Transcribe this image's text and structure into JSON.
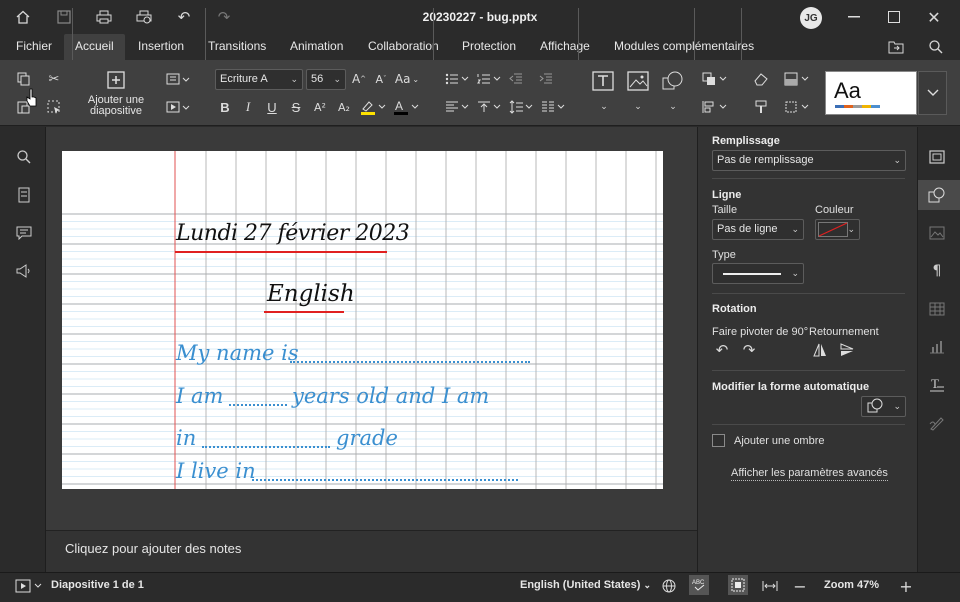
{
  "window": {
    "title": "20230227 - bug.pptx",
    "user_initials": "JG"
  },
  "menu": {
    "tabs": [
      "Fichier",
      "Accueil",
      "Insertion",
      "Transitions",
      "Animation",
      "Collaboration",
      "Protection",
      "Affichage",
      "Modules complémentaires"
    ],
    "active": "Accueil"
  },
  "ribbon": {
    "add_slide_line1": "Ajouter une",
    "add_slide_line2": "diapositive",
    "font_name": "Ecriture A",
    "font_size": "56",
    "font_grow": "A",
    "font_shrink": "A",
    "change_case": "Aa",
    "bold": "B",
    "italic": "I",
    "underline": "U",
    "strike": "S",
    "superscript": "A²",
    "subscript": "A₂",
    "highlight_color": "#ffe200",
    "font_color": "#000000",
    "theme_preview": "Aa"
  },
  "slide": {
    "date": "Lundi 27 février 2023",
    "subject": "English",
    "line1": "My name is",
    "line2a": "I am",
    "line2b": "years old and I am",
    "line3a": "in",
    "line3b": "grade",
    "line4": "I live in",
    "ink_color": "#3a8fd0",
    "underline_color": "#e02020"
  },
  "notes_placeholder": "Cliquez pour ajouter des notes",
  "panel": {
    "fill_heading": "Remplissage",
    "fill_value": "Pas de remplissage",
    "line_heading": "Ligne",
    "size_label": "Taille",
    "color_label": "Couleur",
    "size_value": "Pas de ligne",
    "type_label": "Type",
    "rotation_heading": "Rotation",
    "rotate_label": "Faire pivoter de 90°",
    "flip_label": "Retournement",
    "autoshape_heading": "Modifier la forme automatique",
    "shadow_label": "Ajouter une ombre",
    "advanced_link": "Afficher les paramètres avancés"
  },
  "status": {
    "slide_counter": "Diapositive 1 de 1",
    "language": "English (United States)",
    "zoom": "Zoom 47%"
  }
}
